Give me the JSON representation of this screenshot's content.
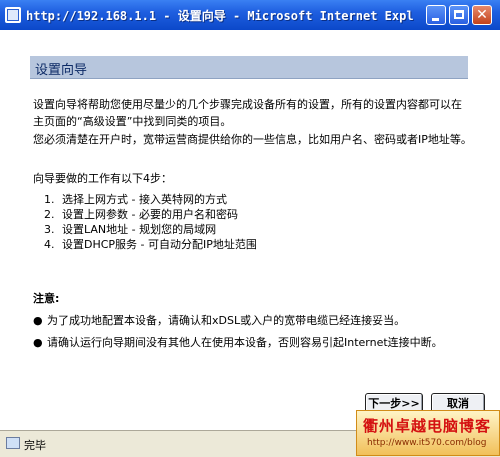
{
  "window": {
    "title": "http://192.168.1.1 - 设置向导 - Microsoft Internet Expl...",
    "buttons": {
      "minimize": "_",
      "maximize": "□",
      "close": "✕"
    }
  },
  "wizard": {
    "header": "设置向导",
    "intro1": "设置向导将帮助您使用尽量少的几个步骤完成设备所有的设置，所有的设置内容都可以在主页面的“高级设置”中找到同类的项目。",
    "intro2": "您必须清楚在开户时，宽带运营商提供给你的一些信息，比如用户名、密码或者IP地址等。",
    "steps_title": "向导要做的工作有以下4步：",
    "steps": [
      {
        "num": "1.",
        "text": "选择上网方式 - 接入英特网的方式"
      },
      {
        "num": "2.",
        "text": "设置上网参数 - 必要的用户名和密码"
      },
      {
        "num": "3.",
        "text": "设置LAN地址 - 规划您的局域网"
      },
      {
        "num": "4.",
        "text": "设置DHCP服务 - 可自动分配IP地址范围"
      }
    ],
    "notes_title": "注意:",
    "notes": [
      "为了成功地配置本设备，请确认和xDSL或入户的宽带电缆已经连接妥当。",
      "请确认运行向导期间没有其他人在使用本设备，否则容易引起Internet连接中断。"
    ],
    "next_label": "下一步>>",
    "cancel_label": "取消"
  },
  "statusbar": {
    "status": "完毕",
    "watermark_title": "衢州卓越电脑博客",
    "watermark_url": "http://www.it570.com/blog"
  },
  "bullet": "●"
}
